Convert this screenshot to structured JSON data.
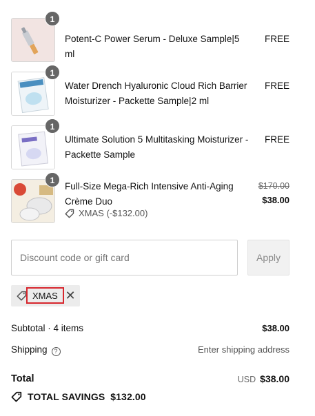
{
  "items": [
    {
      "name": "Potent-C Power Serum - Deluxe Sample|5 ml",
      "qty": "1",
      "price": "FREE"
    },
    {
      "name": "Water Drench Hyaluronic Cloud Rich Barrier Moisturizer - Packette Sample|2 ml",
      "qty": "1",
      "price": "FREE"
    },
    {
      "name": "Ultimate Solution 5 Multitasking Moisturizer - Packette Sample",
      "qty": "1",
      "price": "FREE"
    },
    {
      "name": "Full-Size Mega-Rich Intensive Anti-Aging Crème Duo",
      "qty": "1",
      "original_price": "$170.00",
      "price": "$38.00",
      "discount": "XMAS (-$132.00)"
    }
  ],
  "discount": {
    "placeholder": "Discount code or gift card",
    "apply_label": "Apply",
    "applied_code": "XMAS"
  },
  "summary": {
    "subtotal_label": "Subtotal · 4 items",
    "subtotal_value": "$38.00",
    "shipping_label": "Shipping",
    "shipping_value": "Enter shipping address",
    "total_label": "Total",
    "currency": "USD",
    "total_value": "$38.00",
    "savings_label": "TOTAL SAVINGS",
    "savings_value": "$132.00"
  },
  "colors": {
    "highlight": "#d7262d",
    "chip_bg": "#ececec",
    "qty_badge": "#666666"
  }
}
